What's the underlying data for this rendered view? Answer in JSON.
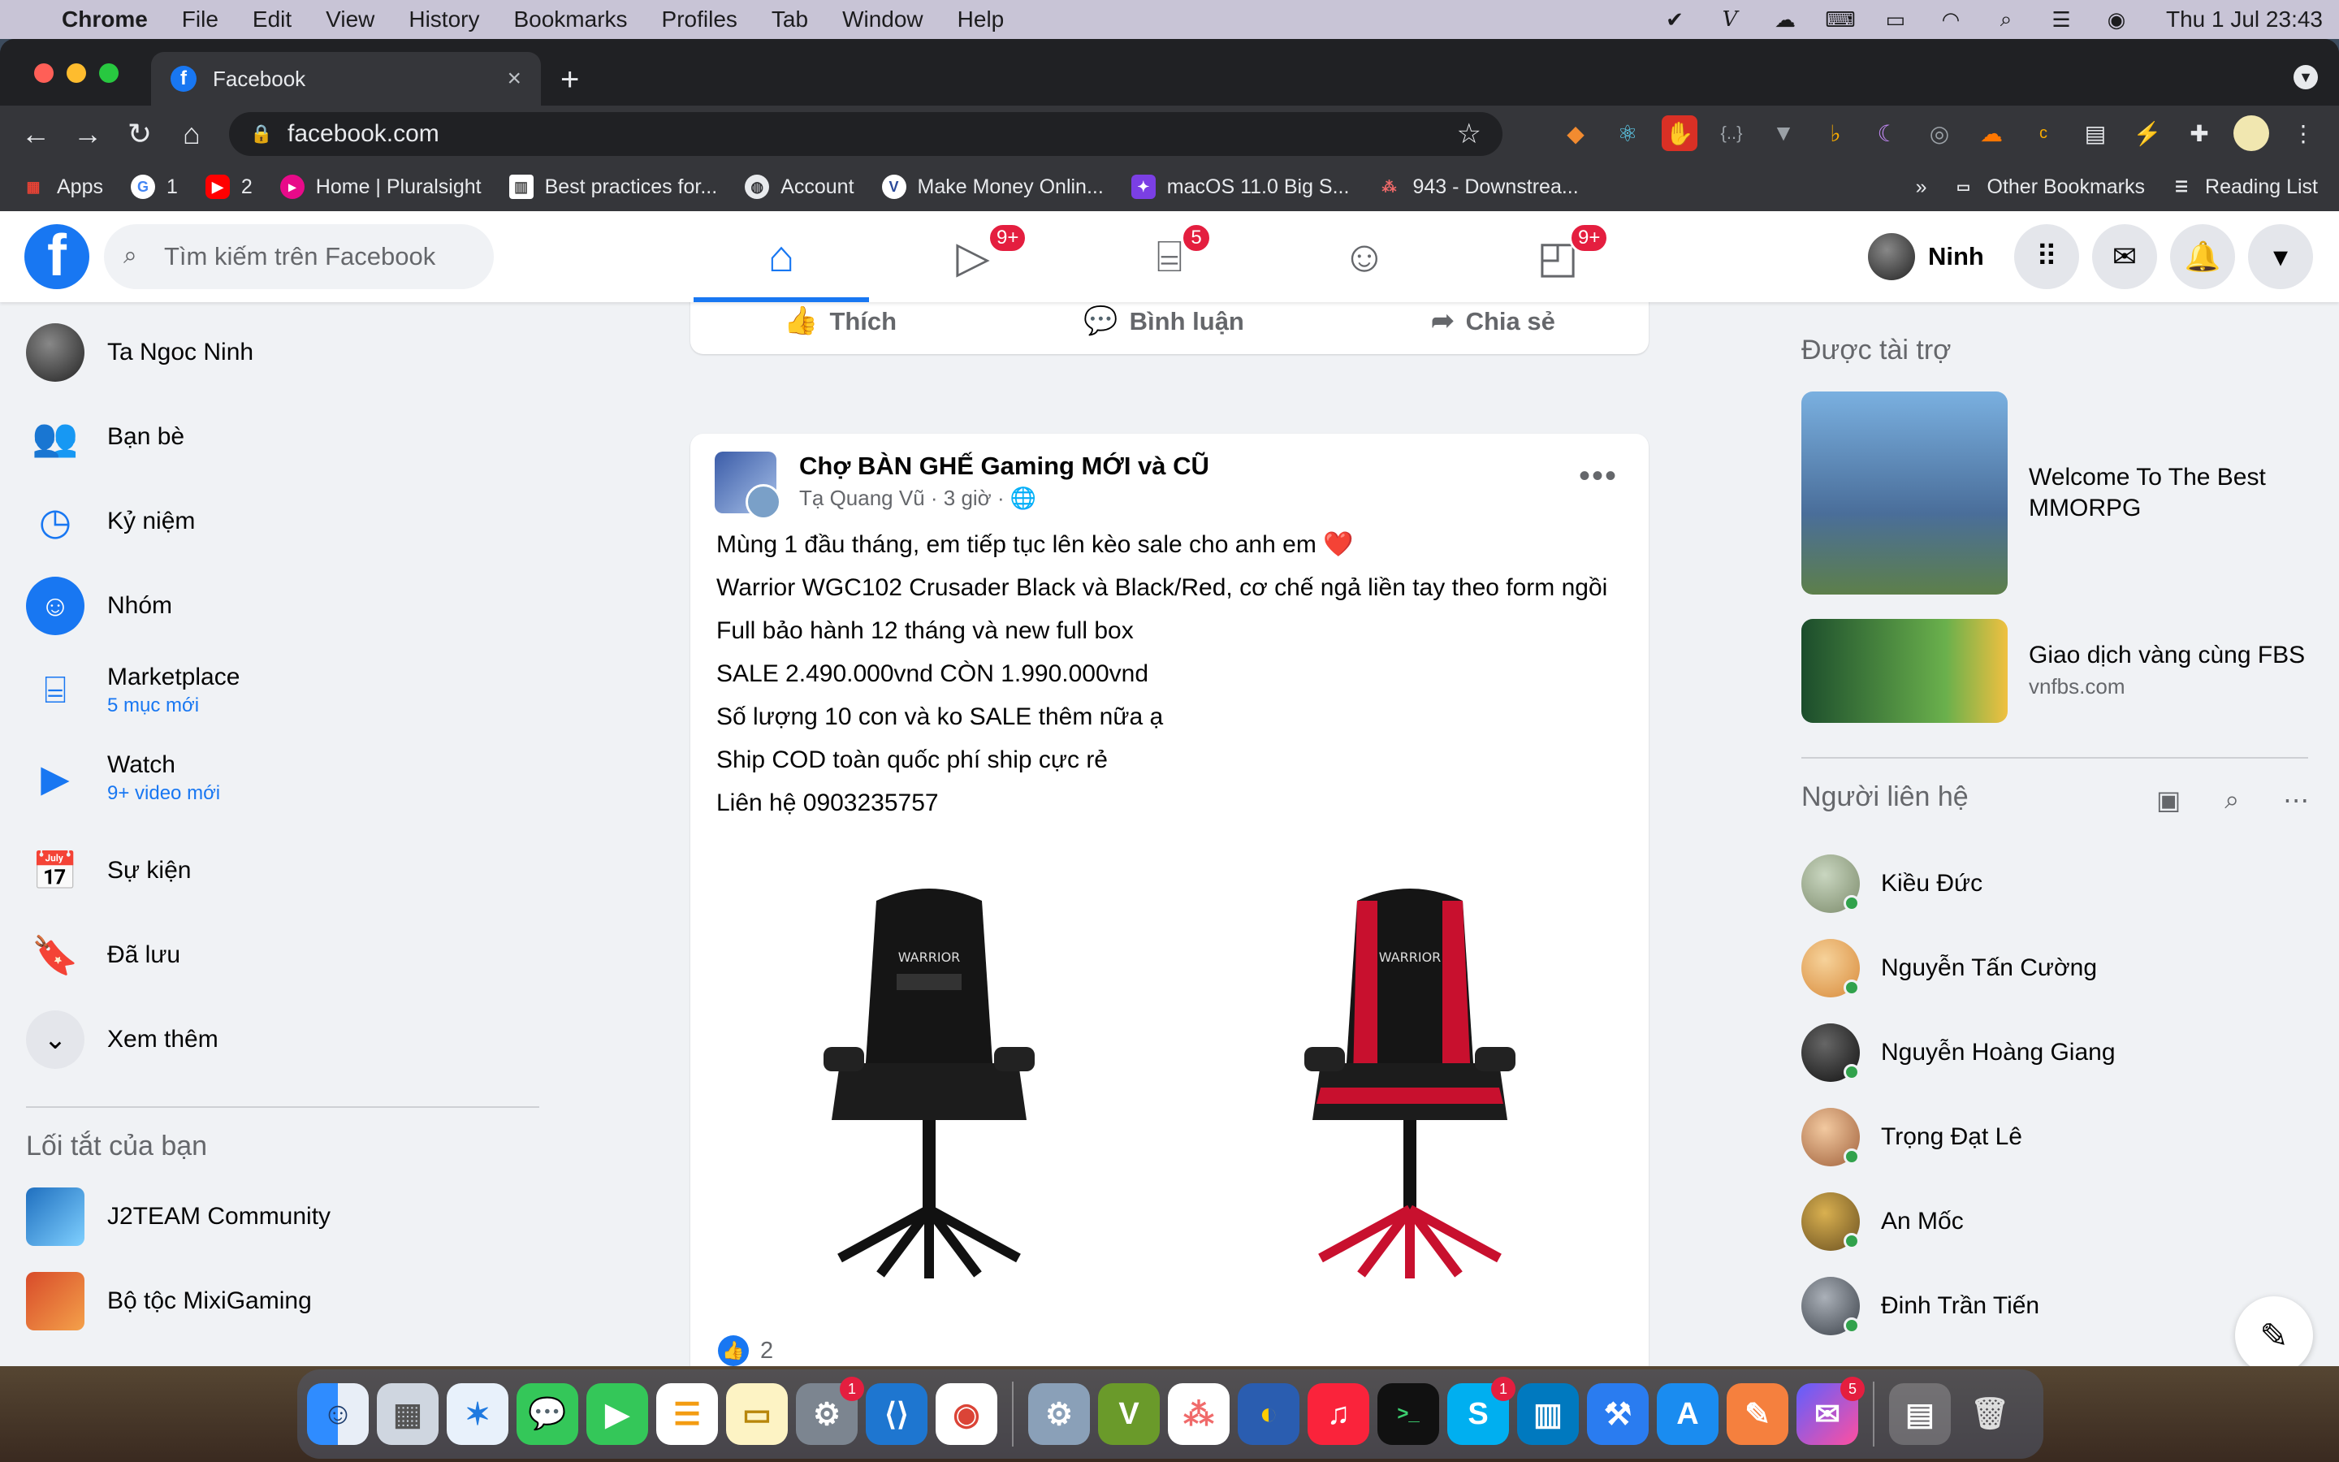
{
  "menubar": {
    "app": "Chrome",
    "items": [
      "File",
      "Edit",
      "View",
      "History",
      "Bookmarks",
      "Profiles",
      "Tab",
      "Window",
      "Help"
    ],
    "clock": "Thu 1 Jul  23:43"
  },
  "browser": {
    "tab_title": "Facebook",
    "url": "facebook.com",
    "bookmarks": [
      {
        "label": "Apps",
        "icon": "apps-grid-icon"
      },
      {
        "label": "1",
        "icon": "google-icon"
      },
      {
        "label": "2",
        "icon": "youtube-icon"
      },
      {
        "label": "Home | Pluralsight",
        "icon": "pluralsight-icon"
      },
      {
        "label": "Best practices for...",
        "icon": "doc-icon"
      },
      {
        "label": "Account",
        "icon": "globe-icon"
      },
      {
        "label": "Make Money Onlin...",
        "icon": "v-icon"
      },
      {
        "label": "macOS 11.0 Big S...",
        "icon": "runner-icon"
      },
      {
        "label": "943 - Downstrea...",
        "icon": "dots-icon"
      }
    ],
    "other_bookmarks": "Other Bookmarks",
    "reading_list": "Reading List",
    "overflow": "»"
  },
  "fb": {
    "search_placeholder": "Tìm kiếm trên Facebook",
    "nav_badges": {
      "watch": "9+",
      "marketplace": "5",
      "gaming": "9+"
    },
    "profile_name": "Ninh",
    "left": {
      "user": "Ta Ngoc Ninh",
      "friends": "Bạn bè",
      "memories": "Kỷ niệm",
      "groups": "Nhóm",
      "marketplace": "Marketplace",
      "marketplace_sub": "5 mục mới",
      "watch": "Watch",
      "watch_sub": "9+ video mới",
      "events": "Sự kiện",
      "saved": "Đã lưu",
      "more": "Xem thêm",
      "shortcuts_title": "Lối tắt của bạn",
      "shortcut_1": "J2TEAM Community",
      "shortcut_2": "Bộ tộc MixiGaming"
    },
    "prev_actions": {
      "like": "Thích",
      "comment": "Bình luận",
      "share": "Chia sẻ"
    },
    "post": {
      "group": "Chợ BÀN GHẾ Gaming MỚI và CŨ",
      "author": "Tạ Quang Vũ",
      "time": "3 giờ",
      "lines": [
        "Mùng 1 đầu tháng, em tiếp tục lên kèo sale cho anh em",
        "Warrior WGC102 Crusader Black và Black/Red, cơ chế ngả liền tay theo form ngồi",
        "Full bảo hành 12 tháng và new full box",
        "SALE 2.490.000vnd CÒN 1.990.000vnd",
        "Số lượng 10 con và ko SALE thêm nữa ạ",
        "Ship COD toàn quốc phí ship cực rẻ",
        "Liên hệ 0903235757"
      ],
      "heart": "❤️",
      "chair_label": "WARRIOR",
      "reactions": "2"
    },
    "right": {
      "sponsored": "Được tài trợ",
      "ad1_title": "Welcome To The Best MMORPG",
      "ad2_title": "Giao dịch vàng cùng FBS",
      "ad2_domain": "vnfbs.com",
      "contacts_title": "Người liên hệ",
      "contacts": [
        "Kiều Đức",
        "Nguyễn Tấn Cường",
        "Nguyễn Hoàng Giang",
        "Trọng Đạt Lê",
        "An Mốc",
        "Đinh Trần Tiến"
      ]
    }
  },
  "dock": {
    "badges": {
      "settings": "1",
      "skype": "1",
      "messenger": "5"
    }
  }
}
